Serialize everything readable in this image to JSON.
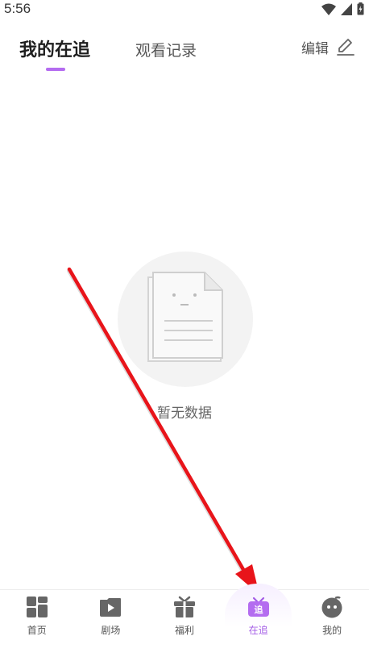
{
  "status_bar": {
    "time": "5:56"
  },
  "header": {
    "tab_following": "我的在追",
    "tab_history": "观看记录",
    "edit_label": "编辑"
  },
  "empty_state": {
    "text": "暂无数据"
  },
  "bottom_nav": {
    "items": [
      {
        "label": "首页",
        "icon": "home-grid-icon",
        "active": false
      },
      {
        "label": "剧场",
        "icon": "play-icon",
        "active": false
      },
      {
        "label": "福利",
        "icon": "gift-icon",
        "active": false
      },
      {
        "label": "在追",
        "icon": "tv-follow-icon",
        "active": true
      },
      {
        "label": "我的",
        "icon": "face-icon",
        "active": false
      }
    ]
  },
  "colors": {
    "accent": "#b46cf0",
    "nav_inactive": "#555555",
    "arrow": "#e8141a"
  }
}
